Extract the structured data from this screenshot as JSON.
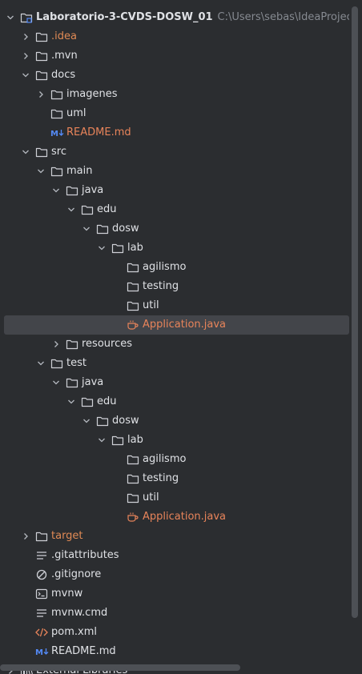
{
  "project": {
    "name": "Laboratorio-3-CVDS-DOSW_01",
    "path": "C:\\Users\\sebas\\IdeaProjects\\Lab"
  },
  "tree": [
    {
      "label": "Laboratorio-3-CVDS-DOSW_01",
      "level": 0,
      "chevron": "down",
      "icon": "module-folder",
      "style": "bold",
      "path": "C:\\Users\\sebas\\IdeaProjects\\Lab"
    },
    {
      "label": ".idea",
      "level": 1,
      "chevron": "right",
      "icon": "folder",
      "style": "excluded"
    },
    {
      "label": ".mvn",
      "level": 1,
      "chevron": "right",
      "icon": "folder"
    },
    {
      "label": "docs",
      "level": 1,
      "chevron": "down",
      "icon": "folder"
    },
    {
      "label": "imagenes",
      "level": 2,
      "chevron": "right",
      "icon": "folder"
    },
    {
      "label": "uml",
      "level": 2,
      "chevron": "none",
      "icon": "folder"
    },
    {
      "label": "README.md",
      "level": 2,
      "chevron": "none",
      "icon": "markdown",
      "style": "modified"
    },
    {
      "label": "src",
      "level": 1,
      "chevron": "down",
      "icon": "folder"
    },
    {
      "label": "main",
      "level": 2,
      "chevron": "down",
      "icon": "folder"
    },
    {
      "label": "java",
      "level": 3,
      "chevron": "down",
      "icon": "folder"
    },
    {
      "label": "edu",
      "level": 4,
      "chevron": "down",
      "icon": "folder"
    },
    {
      "label": "dosw",
      "level": 5,
      "chevron": "down",
      "icon": "folder"
    },
    {
      "label": "lab",
      "level": 6,
      "chevron": "down",
      "icon": "folder"
    },
    {
      "label": "agilismo",
      "level": 7,
      "chevron": "none",
      "icon": "folder"
    },
    {
      "label": "testing",
      "level": 7,
      "chevron": "none",
      "icon": "folder"
    },
    {
      "label": "util",
      "level": 7,
      "chevron": "none",
      "icon": "folder"
    },
    {
      "label": "Application.java",
      "level": 7,
      "chevron": "none",
      "icon": "java",
      "style": "modified",
      "selected": true
    },
    {
      "label": "resources",
      "level": 3,
      "chevron": "right",
      "icon": "folder"
    },
    {
      "label": "test",
      "level": 2,
      "chevron": "down",
      "icon": "folder"
    },
    {
      "label": "java",
      "level": 3,
      "chevron": "down",
      "icon": "folder"
    },
    {
      "label": "edu",
      "level": 4,
      "chevron": "down",
      "icon": "folder"
    },
    {
      "label": "dosw",
      "level": 5,
      "chevron": "down",
      "icon": "folder"
    },
    {
      "label": "lab",
      "level": 6,
      "chevron": "down",
      "icon": "folder"
    },
    {
      "label": "agilismo",
      "level": 7,
      "chevron": "none",
      "icon": "folder"
    },
    {
      "label": "testing",
      "level": 7,
      "chevron": "none",
      "icon": "folder"
    },
    {
      "label": "util",
      "level": 7,
      "chevron": "none",
      "icon": "folder"
    },
    {
      "label": "Application.java",
      "level": 7,
      "chevron": "none",
      "icon": "java",
      "style": "modified"
    },
    {
      "label": "target",
      "level": 1,
      "chevron": "right",
      "icon": "folder",
      "style": "excluded"
    },
    {
      "label": ".gitattributes",
      "level": 1,
      "chevron": "none",
      "icon": "text-file"
    },
    {
      "label": ".gitignore",
      "level": 1,
      "chevron": "none",
      "icon": "ignore-file"
    },
    {
      "label": "mvnw",
      "level": 1,
      "chevron": "none",
      "icon": "terminal-file"
    },
    {
      "label": "mvnw.cmd",
      "level": 1,
      "chevron": "none",
      "icon": "text-file"
    },
    {
      "label": "pom.xml",
      "level": 1,
      "chevron": "none",
      "icon": "xml-file"
    },
    {
      "label": "README.md",
      "level": 1,
      "chevron": "none",
      "icon": "markdown"
    },
    {
      "label": "External Libraries",
      "level": 0,
      "chevron": "right",
      "icon": "library"
    }
  ],
  "colors": {
    "background": "#2b2d30",
    "selection": "#43454a",
    "text": "#dfe1e5",
    "modified": "#e8845a",
    "excluded": "#e08a55",
    "path": "#868a91"
  }
}
